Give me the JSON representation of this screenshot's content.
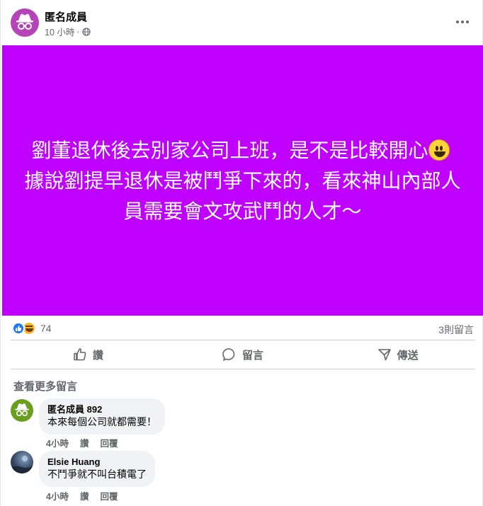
{
  "post": {
    "author": "匿名成員",
    "time": "10 小時",
    "separator": "·",
    "privacy_icon": "globe-icon",
    "more_icon": "more-horizontal-icon",
    "background_color": "#bf00ff",
    "text_before_emoji": "劉董退休後去別家公司上班，是不是比較開心",
    "text_after_emoji": "據說劉提早退休是被鬥爭下來的，看來神山內部人員需要會文攻武鬥的人才～",
    "emoji_icon": "grinning-face-emoji"
  },
  "reactions": {
    "types": [
      "like-reaction-icon",
      "haha-reaction-icon"
    ],
    "count": "74",
    "comments": "3則留言"
  },
  "actions": {
    "like": "讚",
    "comment": "留言",
    "share": "傳送"
  },
  "see_more": "查看更多留言",
  "comments": [
    {
      "author": "匿名成員 892",
      "text": "本來每個公司就都需要！",
      "time": "4小時",
      "like": "讚",
      "reply": "回覆"
    },
    {
      "author": "Elsie Huang",
      "text": "不鬥爭就不叫台積電了",
      "time": "4小時",
      "like": "讚",
      "reply": "回覆"
    }
  ]
}
